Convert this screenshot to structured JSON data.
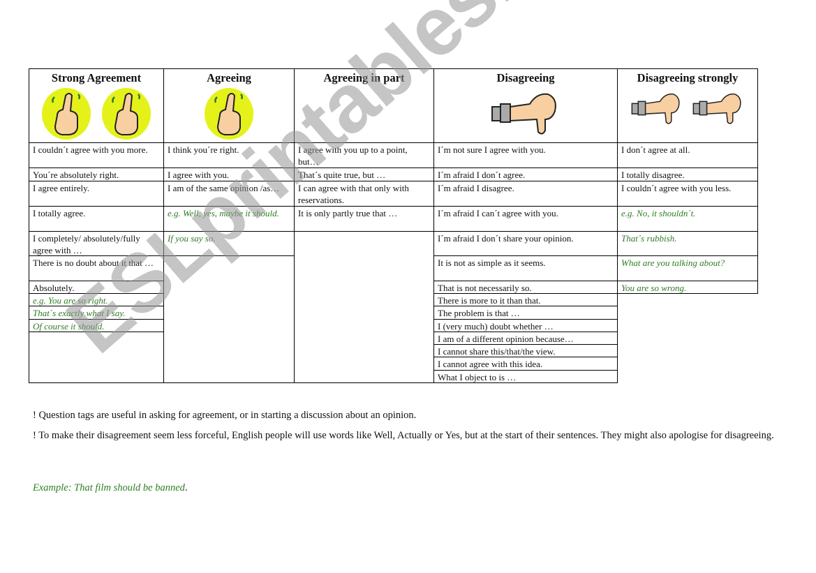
{
  "headers": [
    {
      "label": "Strong Agreement",
      "icon": "thumbs-up-icon",
      "icon_count": 2
    },
    {
      "label": "Agreeing",
      "icon": "thumbs-up-icon",
      "icon_count": 1
    },
    {
      "label": "Agreeing in part",
      "icon": "",
      "icon_count": 0
    },
    {
      "label": "Disagreeing",
      "icon": "thumbs-down-icon",
      "icon_count": 1
    },
    {
      "label": "Disagreeing strongly",
      "icon": "thumbs-down-icon",
      "icon_count": 2
    }
  ],
  "columns": {
    "strong_agreement": [
      {
        "text": "I couldn´t agree with you more.",
        "example": false
      },
      {
        "text": "You´re absolutely right.",
        "example": false
      },
      {
        "text": "I agree entirely.",
        "example": false
      },
      {
        "text": "I totally agree.",
        "example": false
      },
      {
        "text": "I completely/ absolutely/fully agree with …",
        "example": false
      },
      {
        "text": "There is no doubt about it that …",
        "example": false
      },
      {
        "text": "Absolutely.",
        "example": false
      },
      {
        "text": "e.g. You are so right.",
        "example": true
      },
      {
        "text": "That´s exactly what I say.",
        "example": true
      },
      {
        "text": "Of course it should.",
        "example": true
      }
    ],
    "agreeing": [
      {
        "text": "I think you´re right.",
        "example": false
      },
      {
        "text": "I agree with you.",
        "example": false
      },
      {
        "text": "I am of the same opinion /as…",
        "example": false
      },
      {
        "text": "e.g. Well, yes, maybe it should.",
        "example": true
      },
      {
        "text": "If you say so.",
        "example": true
      }
    ],
    "agreeing_in_part": [
      {
        "text": "I agree with you up to a point, but…",
        "example": false
      },
      {
        "text": "That´s quite true, but …",
        "example": false
      },
      {
        "text": "I can agree with that only with reservations.",
        "example": false
      },
      {
        "text": "It is only partly true that …",
        "example": false
      }
    ],
    "disagreeing": [
      {
        "text": "I´m not sure I agree with you.",
        "example": false
      },
      {
        "text": "I´m afraid I don´t agree.",
        "example": false
      },
      {
        "text": "I´m afraid I disagree.",
        "example": false
      },
      {
        "text": "I´m afraid I can´t agree with you.",
        "example": false
      },
      {
        "text": "I´m afraid I don´t share your opinion.",
        "example": false
      },
      {
        "text": "It is not as simple as it seems.",
        "example": false
      },
      {
        "text": "That is not necessarily so.",
        "example": false
      },
      {
        "text": "There is more to it than that.",
        "example": false
      },
      {
        "text": "The problem is that …",
        "example": false
      },
      {
        "text": "I (very much) doubt whether …",
        "example": false
      },
      {
        "text": "I am of a different opinion because…",
        "example": false
      },
      {
        "text": "I cannot share this/that/the view.",
        "example": false
      },
      {
        "text": "I cannot agree with this idea.",
        "example": false
      },
      {
        "text": "What I object to is …",
        "example": false
      }
    ],
    "disagreeing_strongly": [
      {
        "text": "I don´t agree at all.",
        "example": false
      },
      {
        "text": "I totally disagree.",
        "example": false
      },
      {
        "text": "I couldn´t agree with you less.",
        "example": false
      },
      {
        "text": "e.g. No, it shouldn´t.",
        "example": true
      },
      {
        "text": "That´s rubbish.",
        "example": true
      },
      {
        "text": "What are you talking about?",
        "example": true
      },
      {
        "text": "You are so wrong.",
        "example": true
      }
    ]
  },
  "notes": [
    "! Question tags are useful in asking for agreement, or in starting a discussion about an opinion.",
    "! To make their disagreement seem less forceful, English people will use words like Well, Actually or Yes, but at the start of their sentences. They might also apologise for disagreeing."
  ],
  "example_line": {
    "italic": "Example: That film should be banned",
    "suffix": "."
  },
  "watermark": "ESLprintables.com",
  "colors": {
    "example_text": "#2e7d22",
    "border": "#000000",
    "thumb_bg": "#e4f21a",
    "skin": "#f7cfa0",
    "cuff": "#aaaaaa"
  }
}
